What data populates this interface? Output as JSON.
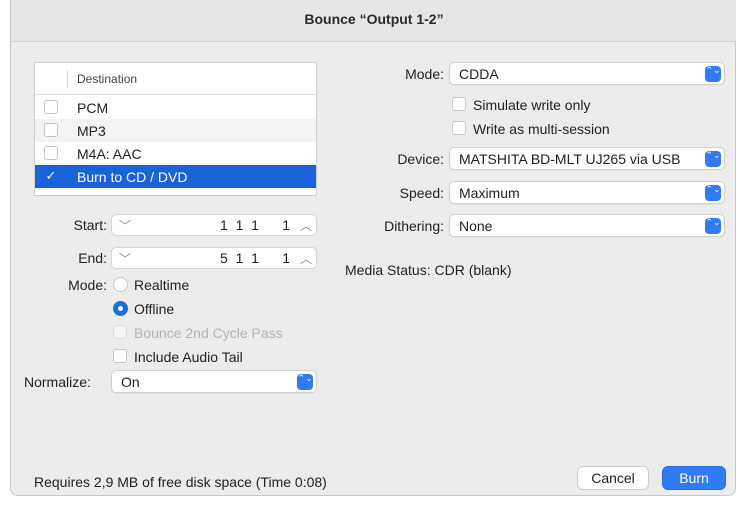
{
  "window": {
    "title": "Bounce “Output 1-2”"
  },
  "destination": {
    "header": "Destination",
    "items": [
      {
        "label": "PCM",
        "checked": false
      },
      {
        "label": "MP3",
        "checked": false
      },
      {
        "label": "M4A: AAC",
        "checked": false
      },
      {
        "label": "Burn to CD / DVD",
        "checked": true
      }
    ]
  },
  "start": {
    "label": "Start:",
    "value": "1  1  1      1"
  },
  "end": {
    "label": "End:",
    "value": "5  1  1      1"
  },
  "mode": {
    "label": "Mode:",
    "options": [
      "Realtime",
      "Offline"
    ],
    "selected": "Offline"
  },
  "bounce_2nd_cycle": {
    "label": "Bounce 2nd Cycle Pass",
    "enabled": false
  },
  "include_audio_tail": {
    "label": "Include Audio Tail",
    "checked": false
  },
  "normalize": {
    "label": "Normalize:",
    "value": "On"
  },
  "burn": {
    "mode_label": "Mode:",
    "mode_value": "CDDA",
    "simulate_label": "Simulate write only",
    "multisession_label": "Write as multi-session",
    "device_label": "Device:",
    "device_value": "MATSHITA BD-MLT UJ265 via USB",
    "speed_label": "Speed:",
    "speed_value": "Maximum",
    "dithering_label": "Dithering:",
    "dithering_value": "None",
    "media_status": "Media Status: CDR (blank)"
  },
  "footer": {
    "disk_info": "Requires 2,9 MB of free disk space  (Time 0:08)",
    "cancel_label": "Cancel",
    "burn_label": "Burn"
  },
  "colors": {
    "accent": "#2f7cf6",
    "selection": "#1a62d8"
  },
  "icons": {
    "check": "✓",
    "chevron_down": "﹀",
    "chevron_up": "︿",
    "popup_arrows": "⌃⌄"
  }
}
